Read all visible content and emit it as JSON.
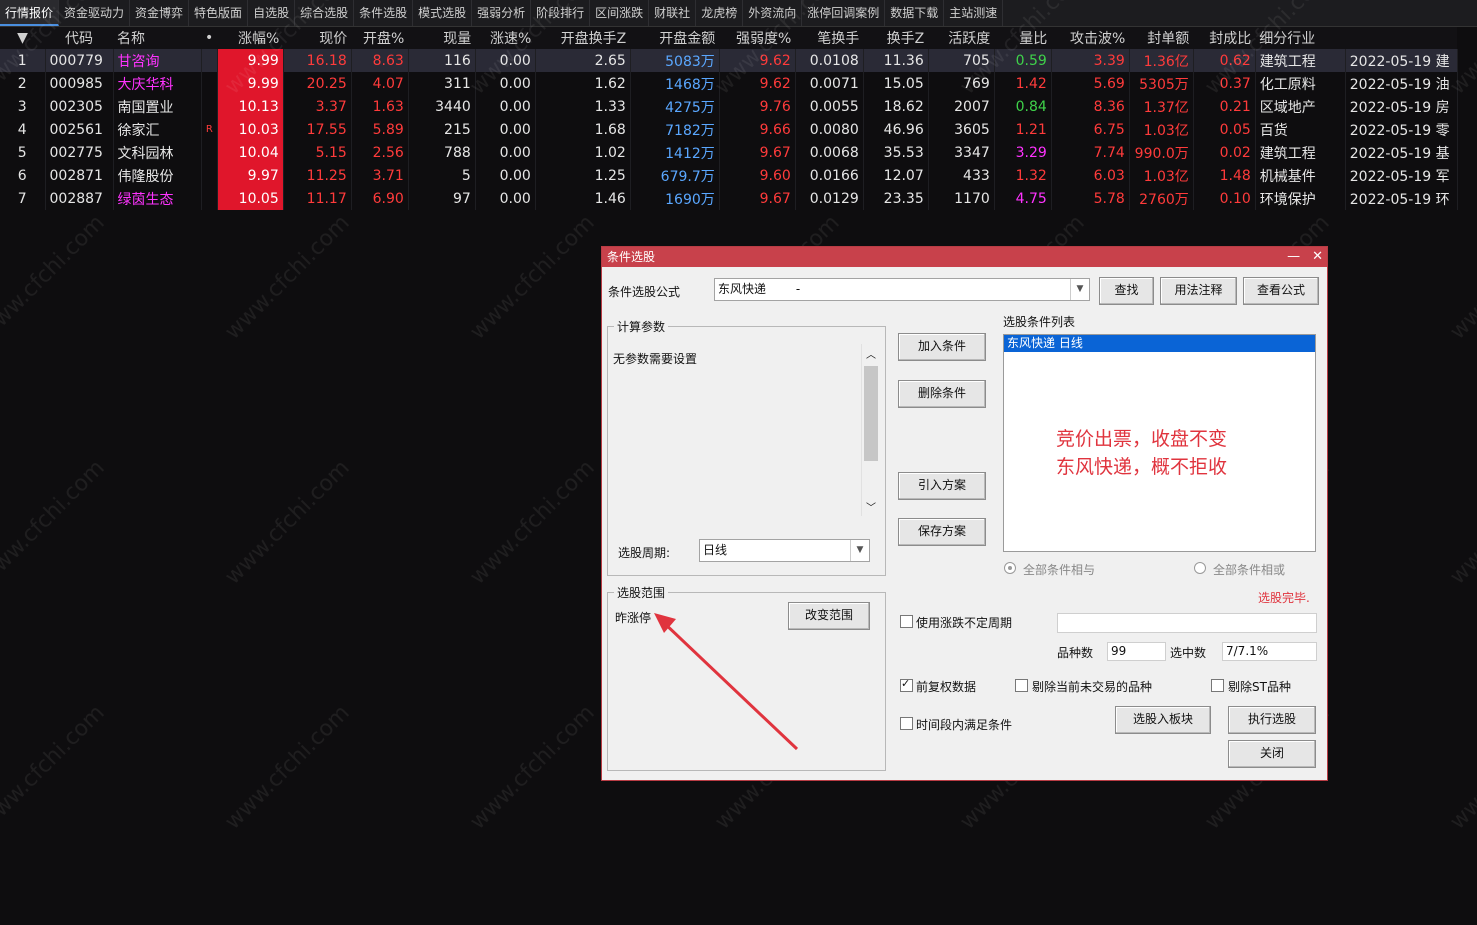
{
  "tabs": [
    "行情报价",
    "资金驱动力",
    "资金博弈",
    "特色版面",
    "自选股",
    "综合选股",
    "条件选股",
    "模式选股",
    "强弱分析",
    "阶段排行",
    "区间涨跌",
    "财联社",
    "龙虎榜",
    "外资流向",
    "涨停回调案例",
    "数据下载",
    "主站测速"
  ],
  "table": {
    "headers": [
      "代码",
      "名称",
      "•",
      "涨幅%",
      "现价",
      "开盘%",
      "现量",
      "涨速%",
      "开盘换手Z",
      "开盘金额",
      "强弱度%",
      "笔换手",
      "换手Z",
      "活跃度",
      "量比",
      "攻击波%",
      "封单额",
      "封成比",
      "细分行业"
    ],
    "rows": [
      {
        "idx": "1",
        "code": "000779",
        "name": "甘咨询",
        "name_color": "mag",
        "flag": "",
        "rise": "9.99",
        "price": "16.18",
        "open": "8.63",
        "vol": "116",
        "speed": "0.00",
        "oturn": "2.65",
        "oamt": "5083万",
        "strong": "9.62",
        "bturn": "0.0108",
        "turn": "11.36",
        "active": "705",
        "qratio": "0.59",
        "qcolor": "green",
        "attack": "3.39",
        "seal": "1.36亿",
        "sratio": "0.62",
        "ind": "建筑工程",
        "date": "2022-05-19 建"
      },
      {
        "idx": "2",
        "code": "000985",
        "name": "大庆华科",
        "name_color": "mag",
        "flag": "",
        "rise": "9.99",
        "price": "20.25",
        "open": "4.07",
        "vol": "311",
        "speed": "0.00",
        "oturn": "1.62",
        "oamt": "1468万",
        "strong": "9.62",
        "bturn": "0.0071",
        "turn": "15.05",
        "active": "769",
        "qratio": "1.42",
        "qcolor": "red",
        "attack": "5.69",
        "seal": "5305万",
        "sratio": "0.37",
        "ind": "化工原料",
        "date": "2022-05-19 油"
      },
      {
        "idx": "3",
        "code": "002305",
        "name": "南国置业",
        "name_color": "white",
        "flag": "",
        "rise": "10.13",
        "price": "3.37",
        "open": "1.63",
        "vol": "3440",
        "speed": "0.00",
        "oturn": "1.33",
        "oamt": "4275万",
        "strong": "9.76",
        "bturn": "0.0055",
        "turn": "18.62",
        "active": "2007",
        "qratio": "0.84",
        "qcolor": "green",
        "attack": "8.36",
        "seal": "1.37亿",
        "sratio": "0.21",
        "ind": "区域地产",
        "date": "2022-05-19 房"
      },
      {
        "idx": "4",
        "code": "002561",
        "name": "徐家汇",
        "name_color": "white",
        "flag": "R",
        "rise": "10.03",
        "price": "17.55",
        "open": "5.89",
        "vol": "215",
        "speed": "0.00",
        "oturn": "1.68",
        "oamt": "7182万",
        "strong": "9.66",
        "bturn": "0.0080",
        "turn": "46.96",
        "active": "3605",
        "qratio": "1.21",
        "qcolor": "red",
        "attack": "6.75",
        "seal": "1.03亿",
        "sratio": "0.05",
        "ind": "百货",
        "date": "2022-05-19 零"
      },
      {
        "idx": "5",
        "code": "002775",
        "name": "文科园林",
        "name_color": "white",
        "flag": "",
        "rise": "10.04",
        "price": "5.15",
        "open": "2.56",
        "vol": "788",
        "speed": "0.00",
        "oturn": "1.02",
        "oamt": "1412万",
        "strong": "9.67",
        "bturn": "0.0068",
        "turn": "35.53",
        "active": "3347",
        "qratio": "3.29",
        "qcolor": "mag",
        "attack": "7.74",
        "seal": "990.0万",
        "sratio": "0.02",
        "ind": "建筑工程",
        "date": "2022-05-19 基"
      },
      {
        "idx": "6",
        "code": "002871",
        "name": "伟隆股份",
        "name_color": "white",
        "flag": "",
        "rise": "9.97",
        "price": "11.25",
        "open": "3.71",
        "vol": "5",
        "speed": "0.00",
        "oturn": "1.25",
        "oamt": "679.7万",
        "strong": "9.60",
        "bturn": "0.0166",
        "turn": "12.07",
        "active": "433",
        "qratio": "1.32",
        "qcolor": "red",
        "attack": "6.03",
        "seal": "1.03亿",
        "sratio": "1.48",
        "ind": "机械基件",
        "date": "2022-05-19 军"
      },
      {
        "idx": "7",
        "code": "002887",
        "name": "绿茵生态",
        "name_color": "mag",
        "flag": "",
        "rise": "10.05",
        "price": "11.17",
        "open": "6.90",
        "vol": "97",
        "speed": "0.00",
        "oturn": "1.46",
        "oamt": "1690万",
        "strong": "9.67",
        "bturn": "0.0129",
        "turn": "23.35",
        "active": "1170",
        "qratio": "4.75",
        "qcolor": "mag",
        "attack": "5.78",
        "seal": "2760万",
        "sratio": "0.10",
        "ind": "环境保护",
        "date": "2022-05-19 环"
      }
    ]
  },
  "dialog": {
    "title": "条件选股",
    "formula_label": "条件选股公式",
    "formula_value": "东风快递",
    "formula_dash": "-",
    "find_btn": "查找",
    "usage_btn": "用法注释",
    "view_btn": "查看公式",
    "params_group": "计算参数",
    "params_text": "无参数需要设置",
    "period_label": "选股周期:",
    "period_value": "日线",
    "range_group": "选股范围",
    "range_value": "昨涨停",
    "change_range_btn": "改变范围",
    "add_btn": "加入条件",
    "del_btn": "删除条件",
    "import_btn": "引入方案",
    "save_btn": "保存方案",
    "list_label": "选股条件列表",
    "list_item": "东风快递  日线",
    "note_line1": "竞价出票，收盘不变",
    "note_line2": "东风快递，概不拒收",
    "radio_and": "全部条件相与",
    "radio_or": "全部条件相或",
    "status": "选股完毕.",
    "use_period_label": "使用涨跌不定周期",
    "count_label": "品种数",
    "count_value": "99",
    "selected_label": "选中数",
    "selected_value": "7/7.1%",
    "fq_label": "前复权数据",
    "exclude_label": "剔除当前未交易的品种",
    "st_label": "剔除ST品种",
    "timerange_label": "时间段内满足条件",
    "to_block_btn": "选股入板块",
    "run_btn": "执行选股",
    "close_btn": "关闭"
  },
  "colors": {
    "accent_red": "#c8414b",
    "rise": "#e0162b",
    "note": "#e0343e"
  },
  "watermark": "www.cfchi.com"
}
